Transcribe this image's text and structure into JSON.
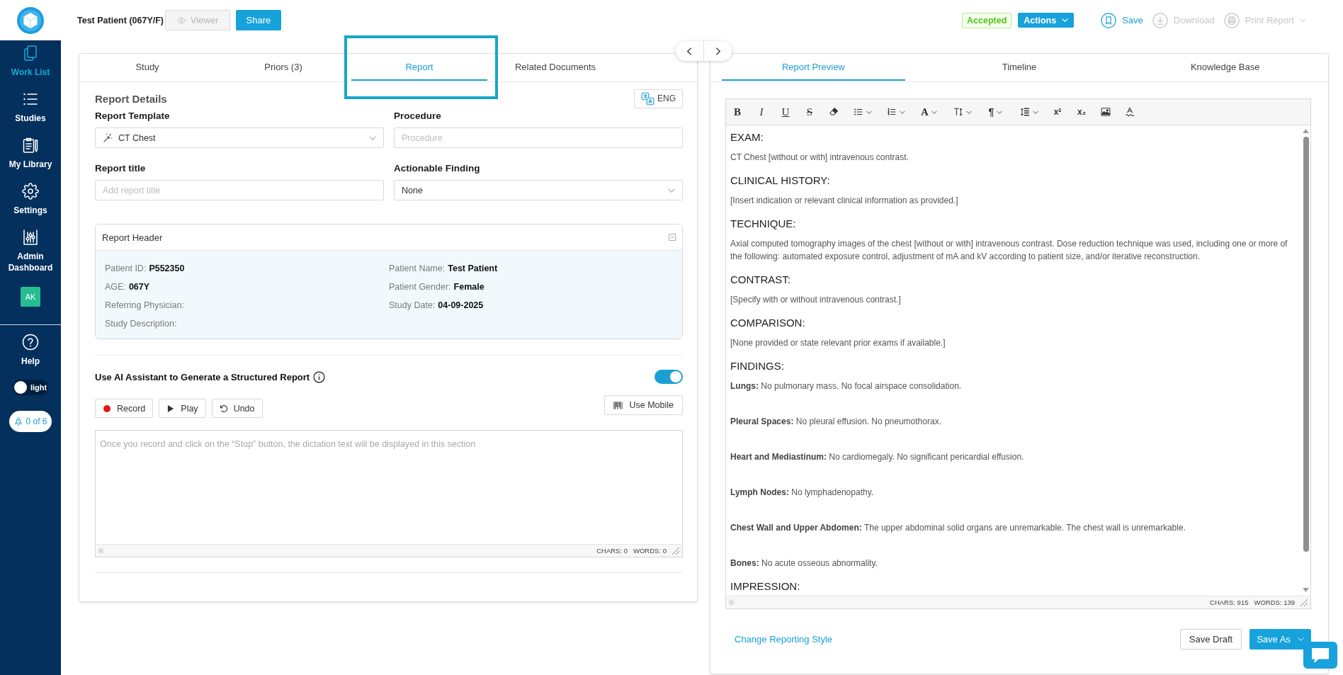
{
  "sidebar": {
    "items": [
      {
        "label": "Work List",
        "selected": true
      },
      {
        "label": "Studies",
        "selected": false
      },
      {
        "label": "My Library",
        "selected": false
      },
      {
        "label": "Settings",
        "selected": false
      },
      {
        "label": "Admin Dashboard",
        "selected": false
      }
    ],
    "avatar": "AK",
    "help": "Help",
    "theme_toggle": {
      "label": "light",
      "on": false
    },
    "tour_badge": "0 of 6"
  },
  "header": {
    "patient": "Test Patient (067Y/F)",
    "buttons": [
      {
        "label": "Viewer",
        "disabled": true
      },
      {
        "label": "Share",
        "disabled": false
      }
    ],
    "status_badge": "Accepted",
    "actions": "Actions",
    "tools": [
      {
        "label": "Save",
        "disabled": false,
        "dropdown": false
      },
      {
        "label": "Download",
        "disabled": true,
        "dropdown": false
      },
      {
        "label": "Print Report",
        "disabled": true,
        "dropdown": true
      }
    ]
  },
  "left_panel": {
    "tabs": [
      {
        "label": "Study",
        "selected": false
      },
      {
        "label": "Priors (3)",
        "selected": false
      },
      {
        "label": "Report",
        "selected": true
      },
      {
        "label": "Related Documents",
        "selected": false
      }
    ],
    "title": "Report Details",
    "language_button": "ENG",
    "fields": [
      {
        "label": "Report Template",
        "kind": "template",
        "value": "CT Chest"
      },
      {
        "label": "Procedure",
        "kind": "input",
        "placeholder": "Procedure"
      },
      {
        "label": "Report title",
        "kind": "input",
        "placeholder": "Add report title"
      },
      {
        "label": "Actionable Finding",
        "kind": "select",
        "value": "None"
      }
    ],
    "report_header": {
      "title": "Report Header",
      "expanded": true,
      "fields": [
        {
          "label": "Patient ID:",
          "value": "P552350"
        },
        {
          "label": "Patient Name:",
          "value": "Test Patient"
        },
        {
          "label": "AGE:",
          "value": "067Y"
        },
        {
          "label": "Patient Gender:",
          "value": "Female"
        },
        {
          "label": "Referring Physician:"
        },
        {
          "label": "Study Date:",
          "value": "04-09-2025"
        },
        {
          "label": "Study Description:"
        }
      ]
    },
    "ai_assistant": {
      "title": "Use AI Assistant to Generate a Structured Report",
      "on": true,
      "buttons": [
        "Record",
        "Play",
        "Undo"
      ],
      "mobile_button": "Use Mobile",
      "dictation": {
        "placeholder": "Once you record and click on the “Stop” button, the dictation text will be displayed in this section",
        "chars": "CHARS: 0",
        "words": "WORDS: 0"
      }
    }
  },
  "right_panel": {
    "tabs": [
      {
        "label": "Report Preview",
        "selected": true
      },
      {
        "label": "Timeline",
        "selected": false
      },
      {
        "label": "Knowledge Base",
        "selected": false
      }
    ],
    "editor": {
      "toolbar": [
        {
          "kind": "bold",
          "text": "B",
          "dropdown": false
        },
        {
          "kind": "italic",
          "text": "I",
          "dropdown": false
        },
        {
          "kind": "underline",
          "text": "U",
          "dropdown": false
        },
        {
          "kind": "strike",
          "text": "S",
          "dropdown": false
        },
        {
          "kind": "eraser",
          "dropdown": false
        },
        {
          "kind": "bullets",
          "dropdown": true
        },
        {
          "kind": "numbers",
          "dropdown": true
        },
        {
          "kind": "color",
          "text": "A",
          "dropdown": true
        },
        {
          "kind": "size",
          "dropdown": true
        },
        {
          "kind": "paragraph",
          "text": "¶",
          "dropdown": true
        },
        {
          "kind": "lineheight",
          "dropdown": true
        },
        {
          "kind": "superscript",
          "text": "x²",
          "dropdown": false
        },
        {
          "kind": "subscript",
          "text": "x₂",
          "dropdown": false
        },
        {
          "kind": "image",
          "dropdown": false
        },
        {
          "kind": "spelling",
          "dropdown": false
        }
      ],
      "sections": [
        {
          "heading": "EXAM:",
          "paragraphs": [
            "CT Chest [without or with] intravenous contrast."
          ]
        },
        {
          "heading": "CLINICAL HISTORY:",
          "paragraphs": [
            "[Insert indication or relevant clinical information as provided.]"
          ]
        },
        {
          "heading": "TECHNIQUE:",
          "paragraphs": [
            "Axial computed tomography images of the chest [without or with] intravenous contrast. Dose reduction technique was used, including one or more of the following: automated exposure control, adjustment of mA and kV according to patient size, and/or iterative reconstruction."
          ]
        },
        {
          "heading": "CONTRAST:",
          "paragraphs": [
            "[Specify with or without intravenous contrast.]"
          ]
        },
        {
          "heading": "COMPARISON:",
          "paragraphs": [
            "[None provided or state relevant prior exams if available.]"
          ]
        },
        {
          "heading": "FINDINGS:",
          "paragraphs": [
            "**Lungs:** No pulmonary mass. No focal airspace consolidation.",
            "**Pleural Spaces:** No pleural effusion. No pneumothorax.",
            "**Heart and Mediastinum:** No cardiomegaly. No significant pericardial effusion.",
            "**Lymph Nodes:** No lymphadenopathy.",
            "**Chest Wall and Upper Abdomen:** The upper abdominal solid organs are unremarkable. The chest wall is unremarkable.",
            "**Bones:** No acute osseous abnormality."
          ]
        },
        {
          "heading": "IMPRESSION:"
        }
      ],
      "chars": "CHARS: 915",
      "words": "WORDS: 139"
    },
    "style_link": "Change Reporting Style",
    "buttons": [
      {
        "label": "Save Draft",
        "kind": "outline",
        "dropdown": false
      },
      {
        "label": "Save As",
        "kind": "primary",
        "dropdown": true
      }
    ]
  }
}
